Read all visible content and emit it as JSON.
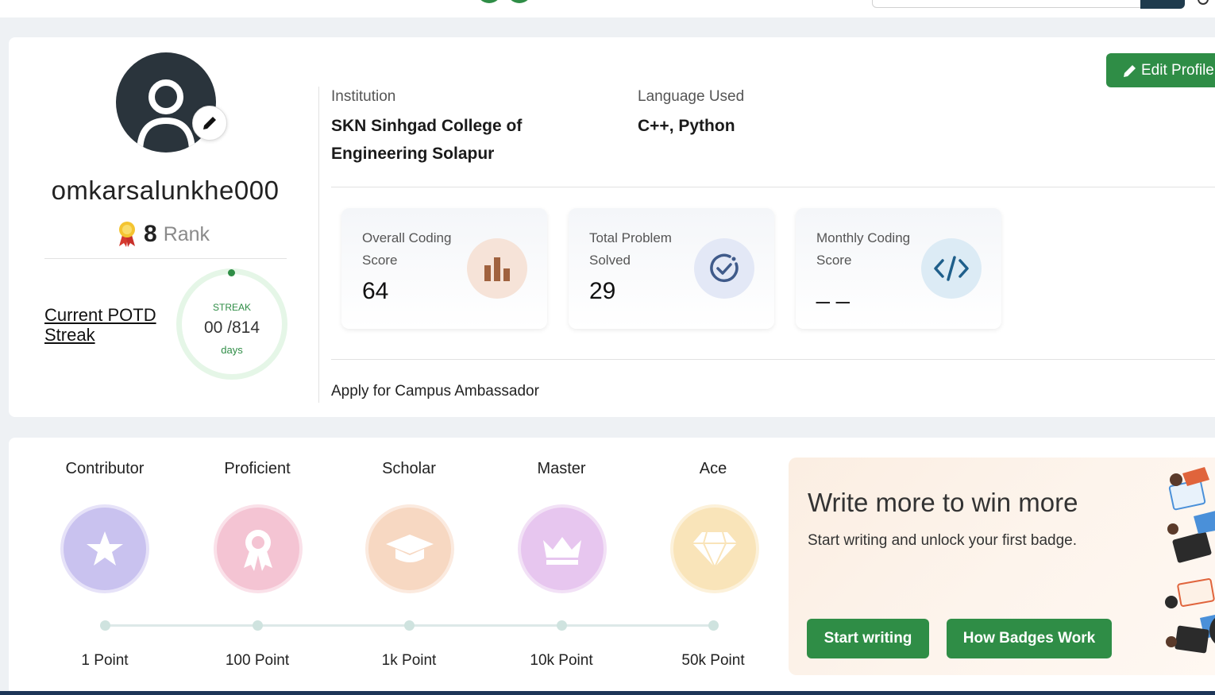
{
  "profile": {
    "username": "omkarsalunkhe000",
    "rank_value": "8",
    "rank_label": "Rank",
    "edit_profile_label": "Edit Profile"
  },
  "streak": {
    "label": "Current POTD Streak",
    "title": "STREAK",
    "count": "00 /814",
    "unit": "days",
    "progress": 0
  },
  "info": {
    "institution_label": "Institution",
    "institution_value": "SKN Sinhgad College of Engineering Solapur",
    "language_label": "Language Used",
    "language_value": "C++, Python"
  },
  "stats": [
    {
      "label": "Overall Coding Score",
      "value": "64",
      "icon": "bar-chart-icon",
      "icon_bg": "#f6e3d8",
      "icon_color": "#a0623f"
    },
    {
      "label": "Total Problem Solved",
      "value": "29",
      "icon": "check-circle-icon",
      "icon_bg": "#e3e8f6",
      "icon_color": "#3f5a8a"
    },
    {
      "label": "Monthly Coding Score",
      "value": "_ _",
      "icon": "code-icon",
      "icon_bg": "#dcebf5",
      "icon_color": "#1f5f8b"
    }
  ],
  "campus_link": "Apply for Campus Ambassador",
  "badges": [
    {
      "name": "Contributor",
      "points": "1 Point",
      "icon": "star-icon",
      "color": "#c9c2ef"
    },
    {
      "name": "Proficient",
      "points": "100 Point",
      "icon": "ribbon-icon",
      "color": "#f4c4d3"
    },
    {
      "name": "Scholar",
      "points": "1k Point",
      "icon": "graduation-cap-icon",
      "color": "#f7d8c2"
    },
    {
      "name": "Master",
      "points": "10k Point",
      "icon": "crown-icon",
      "color": "#e7c6ef"
    },
    {
      "name": "Ace",
      "points": "50k Point",
      "icon": "diamond-icon",
      "color": "#f9e4b9"
    }
  ],
  "promo": {
    "title": "Write more to win more",
    "subtitle": "Start writing and unlock your first badge.",
    "start_button": "Start writing",
    "how_button": "How Badges Work"
  },
  "colors": {
    "accent": "#2f8d46",
    "card_bg": "#ffffff",
    "page_bg": "#eef1f4"
  }
}
